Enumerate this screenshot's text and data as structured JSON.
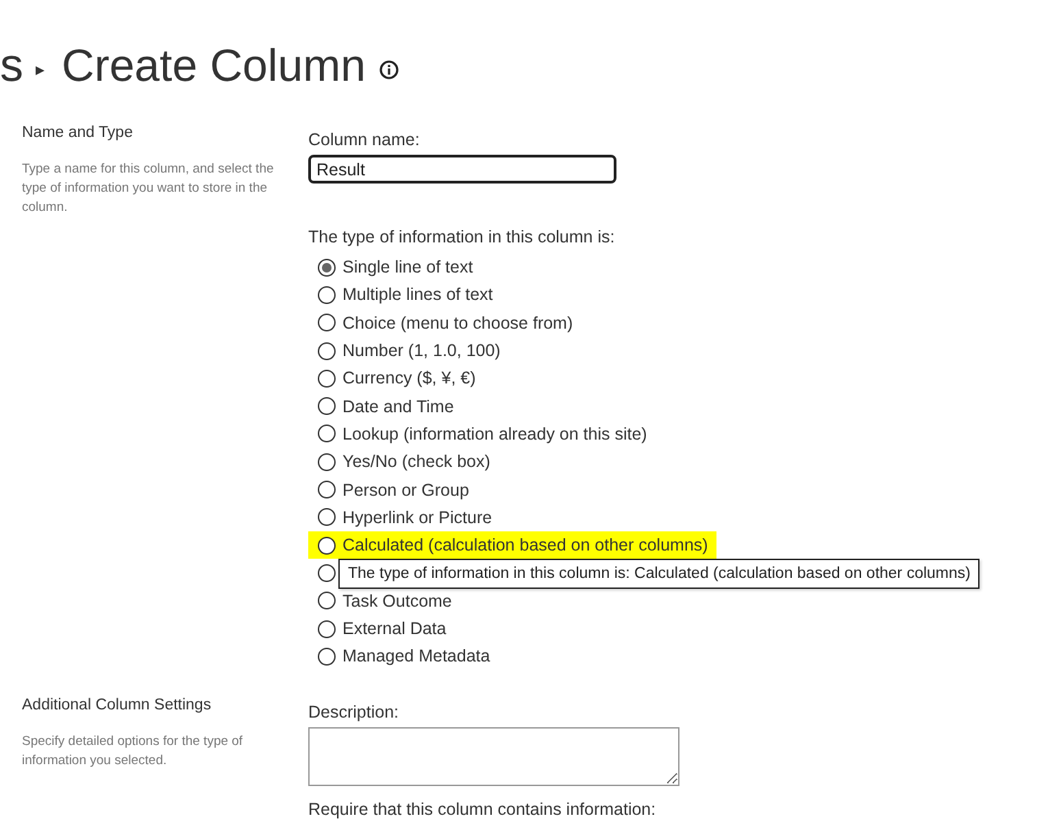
{
  "breadcrumb": {
    "parent": "s",
    "separator": "▸",
    "title": "Create Column"
  },
  "sections": [
    {
      "title": "Name and Type",
      "description": "Type a name for this column, and select the type of information you want to store in the column.",
      "fields": [
        {
          "kind": "text",
          "label": "Column name:",
          "value": "Result"
        },
        {
          "kind": "radios",
          "label": "The type of information in this column is:",
          "options": [
            {
              "label": "Single line of text",
              "selected": true,
              "highlighted": false
            },
            {
              "label": "Multiple lines of text",
              "selected": false,
              "highlighted": false
            },
            {
              "label": "Choice (menu to choose from)",
              "selected": false,
              "highlighted": false
            },
            {
              "label": "Number (1, 1.0, 100)",
              "selected": false,
              "highlighted": false
            },
            {
              "label": "Currency ($, ¥, €)",
              "selected": false,
              "highlighted": false
            },
            {
              "label": "Date and Time",
              "selected": false,
              "highlighted": false
            },
            {
              "label": "Lookup (information already on this site)",
              "selected": false,
              "highlighted": false
            },
            {
              "label": "Yes/No (check box)",
              "selected": false,
              "highlighted": false
            },
            {
              "label": "Person or Group",
              "selected": false,
              "highlighted": false
            },
            {
              "label": "Hyperlink or Picture",
              "selected": false,
              "highlighted": false
            },
            {
              "label": "Calculated (calculation based on other columns)",
              "selected": false,
              "highlighted": true
            },
            {
              "selected": false,
              "highlighted": false
            },
            {
              "label": "Task Outcome",
              "selected": false,
              "highlighted": false
            },
            {
              "label": "External Data",
              "selected": false,
              "highlighted": false
            },
            {
              "label": "Managed Metadata",
              "selected": false,
              "highlighted": false
            }
          ]
        }
      ]
    },
    {
      "title": "Additional Column Settings",
      "description": "Specify detailed options for the type of information you selected.",
      "fields": [
        {
          "kind": "textarea",
          "label": "Description:"
        },
        {
          "kind": "caption",
          "label": "Require that this column contains information:"
        }
      ]
    }
  ],
  "tooltip": {
    "text": "The type of information in this column is: Calculated (calculation based on other columns)"
  }
}
